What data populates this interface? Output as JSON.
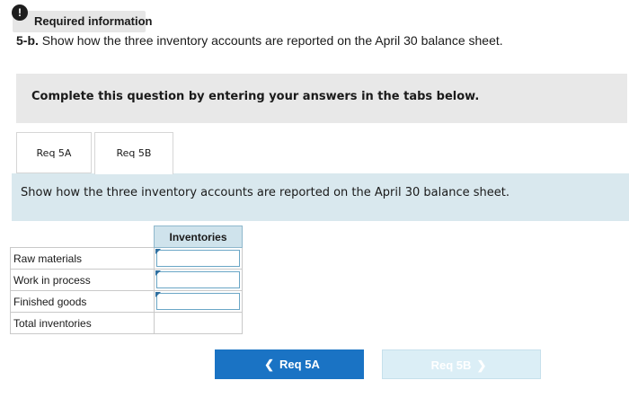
{
  "info": {
    "icon": "info-icon",
    "icon_glyph": "!",
    "label": "Required information"
  },
  "question": {
    "number": "5-b.",
    "text": "Show how the three inventory accounts are reported on the April 30 balance sheet."
  },
  "instruction": "Complete this question by entering your answers in the tabs below.",
  "tabs": [
    {
      "label": "Req 5A",
      "active": false
    },
    {
      "label": "Req 5B",
      "active": true
    }
  ],
  "content": {
    "text": "Show how the three inventory accounts are reported on the April 30 balance sheet."
  },
  "table": {
    "header": "Inventories",
    "rows": [
      {
        "label": "Raw materials",
        "value": ""
      },
      {
        "label": "Work in process",
        "value": ""
      },
      {
        "label": "Finished goods",
        "value": ""
      },
      {
        "label": "Total inventories",
        "value": ""
      }
    ]
  },
  "nav": {
    "prev_label": "Req 5A",
    "prev_icon": "chevron-left-icon",
    "next_label": "Req 5B",
    "next_icon": "chevron-right-icon"
  },
  "colors": {
    "primary_button": "#1a73c4",
    "disabled_button": "#dbeef6",
    "content_panel": "#d9e8ee"
  }
}
